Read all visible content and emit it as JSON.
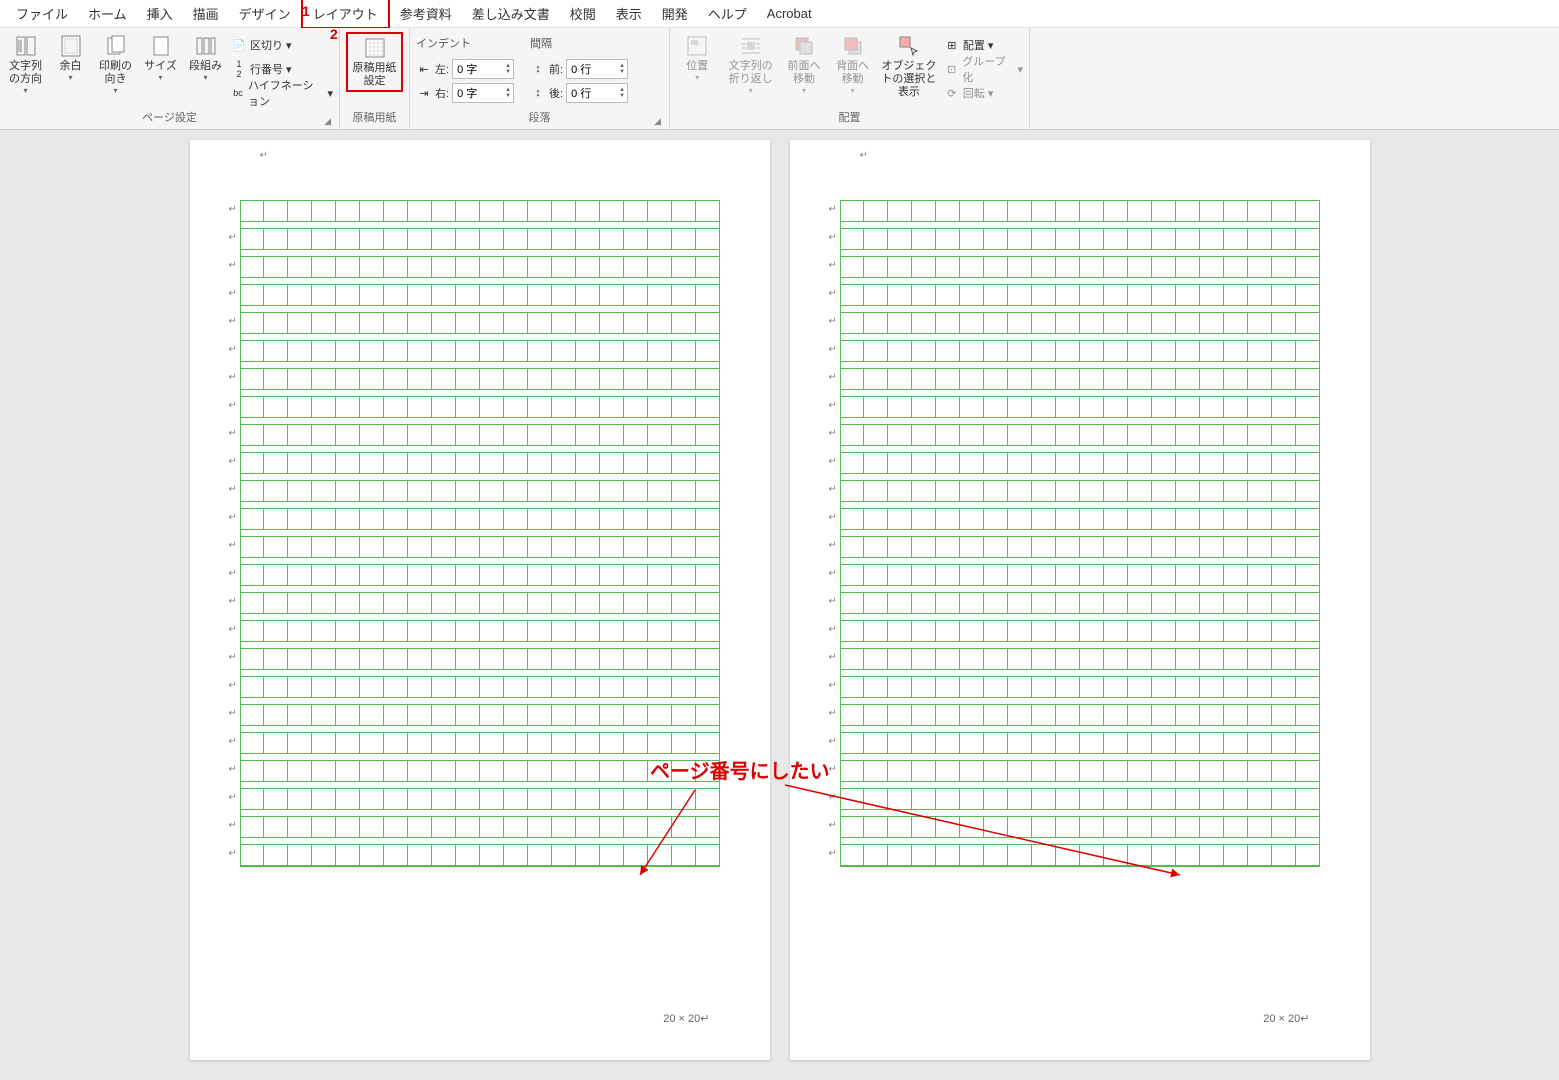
{
  "tabs": {
    "file": "ファイル",
    "home": "ホーム",
    "insert": "挿入",
    "draw": "描画",
    "design": "デザイン",
    "layout": "レイアウト",
    "references": "参考資料",
    "mailings": "差し込み文書",
    "review": "校閲",
    "view": "表示",
    "developer": "開発",
    "help": "ヘルプ",
    "acrobat": "Acrobat"
  },
  "markers": {
    "m1": "1",
    "m2": "2"
  },
  "page_setup": {
    "text_dir": "文字列の方向",
    "margins": "余白",
    "orientation": "印刷の向き",
    "size": "サイズ",
    "columns": "段組み",
    "breaks": "区切り",
    "line_numbers": "行番号",
    "hyphenation": "ハイフネーション",
    "label": "ページ設定"
  },
  "genko": {
    "button": "原稿用紙設定",
    "label": "原稿用紙"
  },
  "indent": {
    "title": "インデント",
    "left_lbl": "左:",
    "right_lbl": "右:",
    "left_val": "0 字",
    "right_val": "0 字"
  },
  "spacing": {
    "title": "間隔",
    "before_lbl": "前:",
    "after_lbl": "後:",
    "before_val": "0 行",
    "after_val": "0 行"
  },
  "paragraph_label": "段落",
  "arrange": {
    "position": "位置",
    "wrap": "文字列の折り返し",
    "bring_forward": "前面へ移動",
    "send_backward": "背面へ移動",
    "selection_pane": "オブジェクトの選択と表示",
    "align": "配置",
    "group": "グループ化",
    "rotate": "回転",
    "label": "配置"
  },
  "doc": {
    "page_size_text": "20 × 20"
  },
  "annotation": "ページ番号にしたい"
}
